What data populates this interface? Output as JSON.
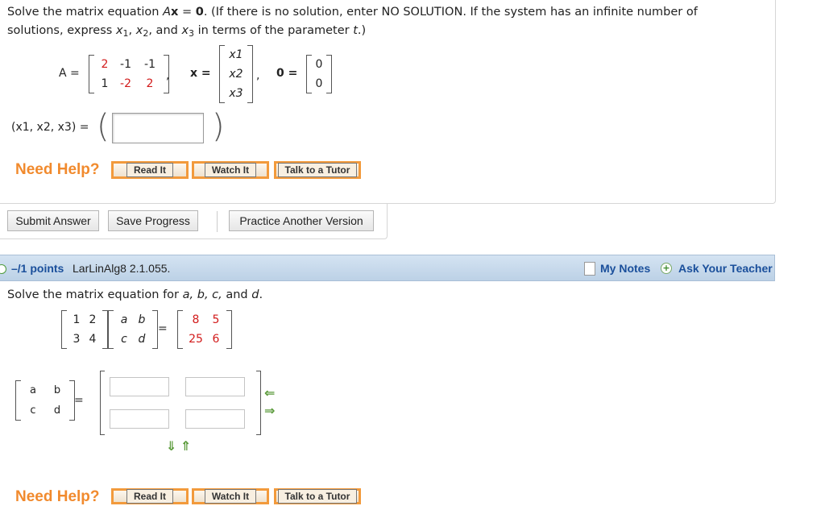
{
  "q1": {
    "intro_a": "Solve the matrix equation ",
    "intro_var": "A",
    "intro_x": "x",
    "intro_eq": " = ",
    "intro_zero": "0",
    "intro_b": ". (If there is no solution, enter NO SOLUTION. If the system has an infinite number of",
    "line2_a": "solutions, express ",
    "line2_x1": "x",
    "line2_s1": "1",
    "line2_comma1": ", ",
    "line2_x2": "x",
    "line2_s2": "2",
    "line2_and": ", and ",
    "line2_x3": "x",
    "line2_s3": "3",
    "line2_b": " in terms of the parameter ",
    "line2_t": "t",
    "line2_c": ".)",
    "A_label": "A =",
    "A_matrix": [
      [
        "2",
        "-1",
        "-1"
      ],
      [
        "1",
        "-2",
        "2"
      ]
    ],
    "x_label": "x =",
    "x_entries": [
      "x1",
      "x2",
      "x3"
    ],
    "zero_label": "0 =",
    "zero_entries": [
      "0",
      "0"
    ],
    "answer_label": "(x1, x2, x3) ="
  },
  "help": {
    "need_help": "Need Help?",
    "read_it": "Read It",
    "watch_it": "Watch It",
    "talk_tutor": "Talk to a Tutor"
  },
  "actions": {
    "submit": "Submit Answer",
    "save": "Save Progress",
    "practice": "Practice Another Version"
  },
  "q2_header": {
    "points": "–/1 points",
    "code": "LarLinAlg8 2.1.055.",
    "my_notes": "My Notes",
    "ask_teacher": "Ask Your Teacher"
  },
  "q2": {
    "prompt_a": "Solve the matrix equation for ",
    "prompt_vars": "a, b, c,",
    "prompt_and": " and ",
    "prompt_d": "d",
    "prompt_end": ".",
    "M1": [
      [
        "1",
        "2"
      ],
      [
        "3",
        "4"
      ]
    ],
    "M2": [
      [
        "a",
        "b"
      ],
      [
        "c",
        "d"
      ]
    ],
    "M3": [
      [
        "8",
        "5"
      ],
      [
        "25",
        "6"
      ]
    ],
    "eq": "=",
    "abcd": [
      [
        "a",
        "b"
      ],
      [
        "c",
        "d"
      ]
    ]
  },
  "colors": {
    "accent_orange": "#f18a2d",
    "link_blue": "#1a4f9b",
    "red_values": "#d21b1b",
    "arrow_green": "#5a9a3a"
  },
  "icons": [
    "plus-icon",
    "notes-icon",
    "arrow-left-icon",
    "arrow-right-icon",
    "arrow-down-icon",
    "arrow-up-icon"
  ]
}
